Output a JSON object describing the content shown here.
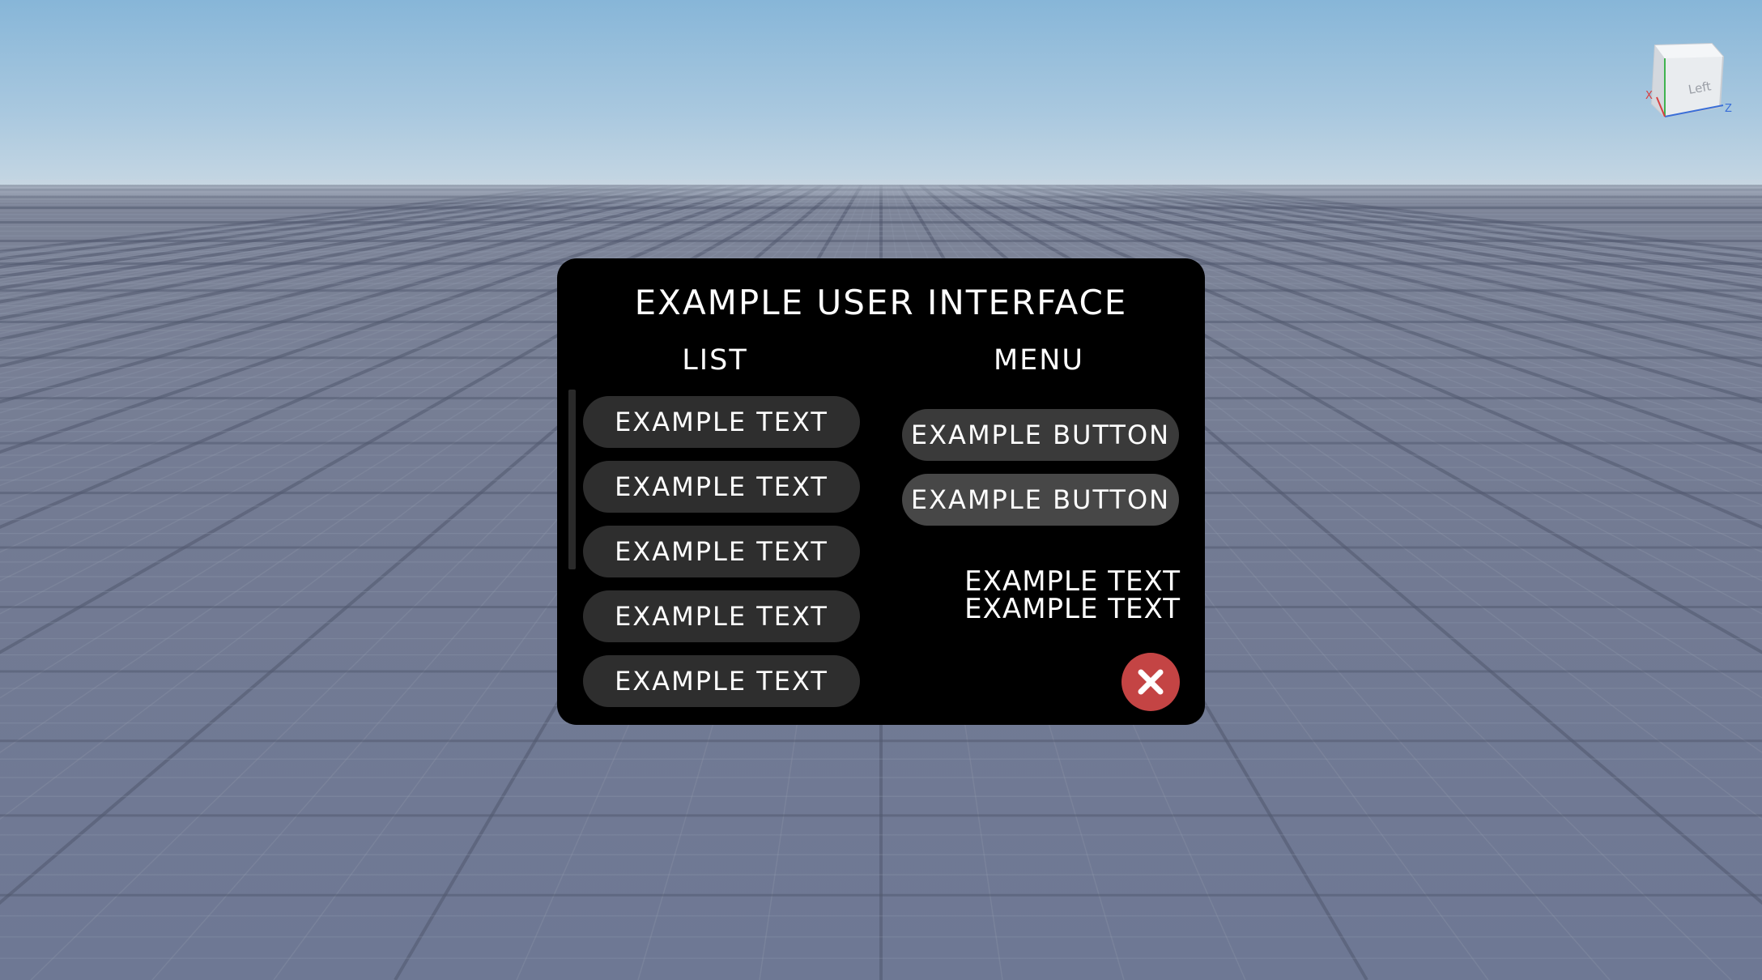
{
  "viewport": {
    "view_cube_face_label": "Left",
    "axis_x_label": "X",
    "axis_z_label": "Z"
  },
  "panel": {
    "title": "EXAMPLE USER INTERFACE",
    "list": {
      "heading": "LIST",
      "items": [
        {
          "label": "EXAMPLE TEXT"
        },
        {
          "label": "EXAMPLE TEXT"
        },
        {
          "label": "EXAMPLE TEXT"
        },
        {
          "label": "EXAMPLE TEXT"
        },
        {
          "label": "EXAMPLE TEXT"
        }
      ]
    },
    "menu": {
      "heading": "MENU",
      "buttons": [
        {
          "label": "EXAMPLE BUTTON"
        },
        {
          "label": "EXAMPLE BUTTON"
        }
      ],
      "text_line_1": "EXAMPLE TEXT",
      "text_line_2": "EXAMPLE TEXT"
    },
    "close_icon": "close-x-icon"
  },
  "colors": {
    "panel_bg": "#000000",
    "list_item_bg": "#2e2e2e",
    "button_bg": "#3a3a3a",
    "close_button_bg": "#c44444",
    "text": "#ffffff"
  }
}
